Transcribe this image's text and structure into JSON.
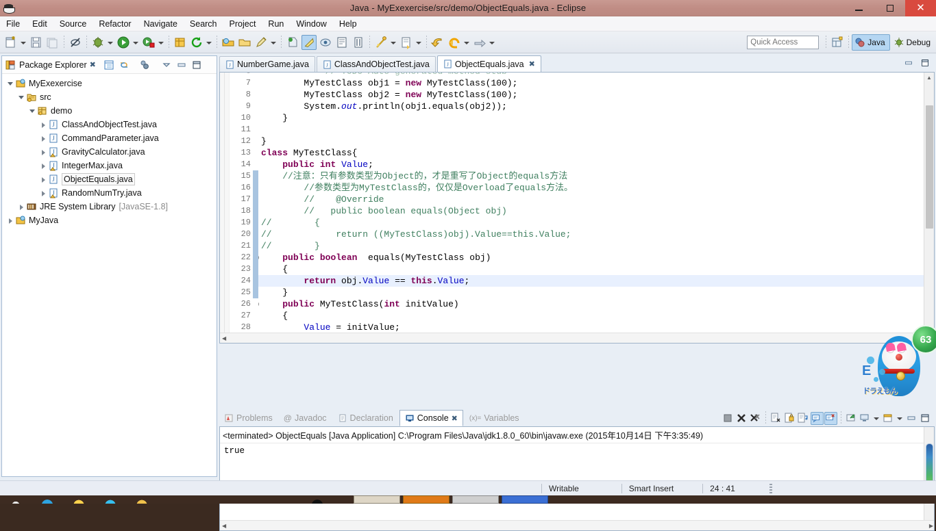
{
  "window": {
    "title": "Java - MyExexercise/src/demo/ObjectEquals.java - Eclipse",
    "minimize_label": "–",
    "maximize_label": "□",
    "close_label": "✕"
  },
  "menubar": {
    "items": [
      "File",
      "Edit",
      "Source",
      "Refactor",
      "Navigate",
      "Search",
      "Project",
      "Run",
      "Window",
      "Help"
    ]
  },
  "toolbar": {
    "quick_access_placeholder": "Quick Access",
    "perspectives": [
      {
        "label": "Java",
        "active": true
      },
      {
        "label": "Debug",
        "active": false
      }
    ],
    "icons": [
      "new-java-project-icon",
      "new-dropdown-icon",
      "save-icon",
      "save-all-icon",
      "link-break-icon",
      "debug-icon",
      "debug-dropdown-icon",
      "run-icon",
      "run-dropdown-icon",
      "run-external-tools-icon",
      "external-tools-dropdown-icon",
      "new-java-class-icon",
      "refresh-icon",
      "refresh-dropdown-icon",
      "open-type-icon",
      "open-resource-icon",
      "search-icon",
      "search-dropdown-icon",
      "next-annotation-icon",
      "last-edit-location-icon",
      "toggle-mark-occurrences-icon",
      "show-whitespace-icon",
      "block-selection-icon",
      "previous-edit-icon",
      "previous-dropdown-icon",
      "forward-icon",
      "back-icon",
      "back-dropdown-icon",
      "forward-nav-icon",
      "forward-nav-dropdown-icon"
    ]
  },
  "package_explorer": {
    "title": "Package Explorer",
    "close_label": "✖",
    "toolbar_icons": [
      "collapse-all-icon",
      "link-with-editor-icon",
      "view-menu-icon",
      "minimize-icon",
      "maximize-icon"
    ],
    "tree": [
      {
        "label": "MyExexercise",
        "indent": 0,
        "twisty": "open",
        "icon": "java-project-icon",
        "selected": false
      },
      {
        "label": "src",
        "indent": 1,
        "twisty": "open",
        "icon": "source-folder-icon",
        "selected": false
      },
      {
        "label": "demo",
        "indent": 2,
        "twisty": "open",
        "icon": "package-icon",
        "selected": false
      },
      {
        "label": "ClassAndObjectTest.java",
        "indent": 3,
        "twisty": "closed",
        "icon": "java-file-icon",
        "selected": false
      },
      {
        "label": "CommandParameter.java",
        "indent": 3,
        "twisty": "closed",
        "icon": "java-file-icon",
        "selected": false
      },
      {
        "label": "GravityCalculator.java",
        "indent": 3,
        "twisty": "closed",
        "icon": "java-file-warn-icon",
        "selected": false
      },
      {
        "label": "IntegerMax.java",
        "indent": 3,
        "twisty": "closed",
        "icon": "java-file-warn-icon",
        "selected": false
      },
      {
        "label": "ObjectEquals.java",
        "indent": 3,
        "twisty": "closed",
        "icon": "java-file-icon",
        "selected": true
      },
      {
        "label": "RandomNumTry.java",
        "indent": 3,
        "twisty": "closed",
        "icon": "java-file-warn-icon",
        "selected": false
      },
      {
        "label": "JRE System Library",
        "suffix": "[JavaSE-1.8]",
        "indent": 1,
        "twisty": "closed",
        "icon": "library-icon",
        "selected": false
      },
      {
        "label": "MyJava",
        "indent": 0,
        "twisty": "closed",
        "icon": "java-project-icon",
        "selected": false
      }
    ]
  },
  "editor": {
    "tabs": [
      {
        "label": "NumberGame.java",
        "active": false,
        "closable": false
      },
      {
        "label": "ClassAndObjectTest.java",
        "active": false,
        "closable": false
      },
      {
        "label": "ObjectEquals.java",
        "active": true,
        "closable": true
      }
    ],
    "tab_close_label": "✖",
    "minimize_icon": "minimize-icon",
    "maximize_icon": "maximize-icon",
    "first_visible_line": 6,
    "lines": [
      {
        "n": 6,
        "text": "            // TODO Auto-generated method stub",
        "clipped": true,
        "fold": false,
        "changed": false
      },
      {
        "n": 7,
        "text": "        MyTestClass obj1 = new MyTestClass(100);",
        "fold": false,
        "changed": false
      },
      {
        "n": 8,
        "text": "        MyTestClass obj2 = new MyTestClass(100);",
        "fold": false,
        "changed": false
      },
      {
        "n": 9,
        "text": "        System.out.println(obj1.equals(obj2));",
        "fold": false,
        "changed": false
      },
      {
        "n": 10,
        "text": "    }",
        "fold": false,
        "changed": false
      },
      {
        "n": 11,
        "text": "",
        "fold": false,
        "changed": false
      },
      {
        "n": 12,
        "text": "}",
        "fold": false,
        "changed": false
      },
      {
        "n": 13,
        "text": "class MyTestClass{",
        "fold": false,
        "changed": false
      },
      {
        "n": 14,
        "text": "    public int Value;",
        "fold": false,
        "changed": false
      },
      {
        "n": 15,
        "text": "    //注意：只有参数类型为Object的，才是重写了Object的equals方法",
        "fold": false,
        "changed": true
      },
      {
        "n": 16,
        "text": "        //参数类型为MyTestClass的，仅仅是Overload了equals方法。",
        "fold": false,
        "changed": true
      },
      {
        "n": 17,
        "text": "        //    @Override",
        "fold": false,
        "changed": true
      },
      {
        "n": 18,
        "text": "        //   public boolean equals(Object obj)",
        "fold": false,
        "changed": true
      },
      {
        "n": 19,
        "text": "//        {",
        "fold": false,
        "changed": true
      },
      {
        "n": 20,
        "text": "//            return ((MyTestClass)obj).Value==this.Value;",
        "fold": false,
        "changed": true
      },
      {
        "n": 21,
        "text": "//        }",
        "fold": false,
        "changed": true
      },
      {
        "n": 22,
        "text": "    public boolean  equals(MyTestClass obj)",
        "fold": true,
        "changed": true
      },
      {
        "n": 23,
        "text": "    {",
        "fold": false,
        "changed": true
      },
      {
        "n": 24,
        "text": "        return obj.Value == this.Value;",
        "fold": false,
        "changed": true,
        "highlight": true
      },
      {
        "n": 25,
        "text": "    }",
        "fold": false,
        "changed": true
      },
      {
        "n": 26,
        "text": "    public MyTestClass(int initValue)",
        "fold": true,
        "changed": false
      },
      {
        "n": 27,
        "text": "    {",
        "fold": false,
        "changed": false
      },
      {
        "n": 28,
        "text": "        Value = initValue;",
        "fold": false,
        "changed": false
      },
      {
        "n": 29,
        "text": "    }",
        "clipped": true,
        "fold": false,
        "changed": false
      }
    ]
  },
  "console": {
    "tabs": [
      {
        "label": "Problems",
        "icon": "problems-icon",
        "active": false
      },
      {
        "label": "Javadoc",
        "icon": "javadoc-icon",
        "active": false
      },
      {
        "label": "Declaration",
        "icon": "declaration-icon",
        "active": false
      },
      {
        "label": "Console",
        "icon": "console-icon",
        "active": true
      },
      {
        "label": "Variables",
        "icon": "variables-icon",
        "active": false
      }
    ],
    "tab_close_label": "✖",
    "header": "<terminated> ObjectEquals [Java Application] C:\\Program Files\\Java\\jdk1.8.0_60\\bin\\javaw.exe (2015年10月14日 下午3:35:49)",
    "output": "true",
    "toolbar_icons": [
      "terminate-icon",
      "remove-launch-icon",
      "remove-all-launches-icon",
      "clear-console-icon",
      "scroll-lock-icon",
      "word-wrap-icon",
      "show-console-on-output-icon",
      "show-console-on-error-icon",
      "pin-console-icon",
      "display-selected-console-icon",
      "display-console-dropdown-icon",
      "open-console-icon",
      "open-console-dropdown-icon",
      "minimize-icon",
      "maximize-icon"
    ],
    "toolbar_active": [
      "show-console-on-output-icon",
      "show-console-on-error-icon"
    ]
  },
  "statusbar": {
    "writable": "Writable",
    "insert_mode": "Smart Insert",
    "cursor_position": "24 : 41"
  },
  "wallpaper": {
    "badge_text": "63",
    "logo_text": "ドラえもん"
  },
  "colors": {
    "title_bar": "#c08d85",
    "accent_selection": "#b5d6f2",
    "keyword": "#7f0055",
    "comment": "#3f7f5f",
    "field": "#0000c0",
    "occurrence_highlight": "#e0d4e8",
    "current_line": "#e8f0fe",
    "changed_bar": "#a8c4e0"
  }
}
